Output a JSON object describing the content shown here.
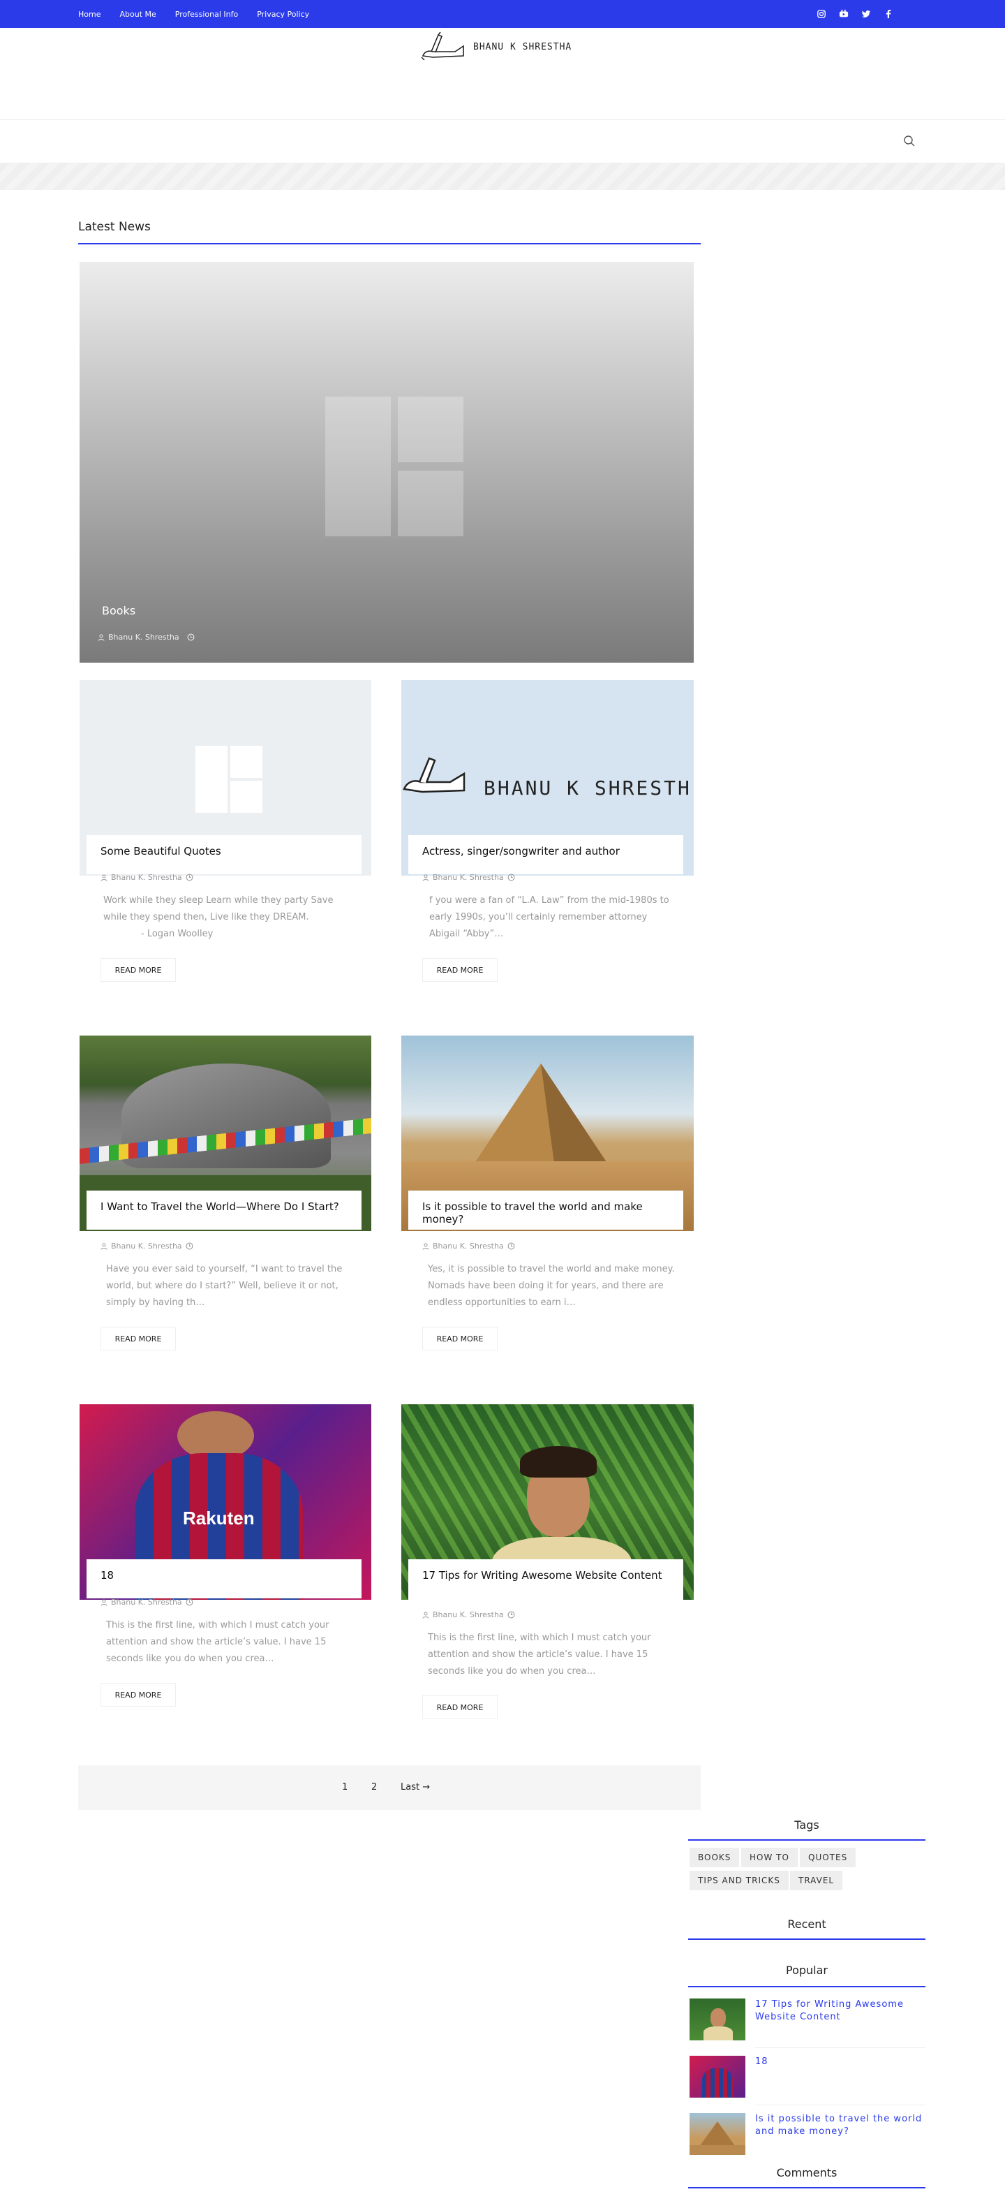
{
  "nav": {
    "items": [
      "Home",
      "About Me",
      "Professional Info",
      "Privacy Policy"
    ]
  },
  "social": [
    "instagram-icon",
    "youtube-icon",
    "twitter-icon",
    "facebook-icon"
  ],
  "brand": {
    "logo_text": "BHANU K SHRESTHA",
    "accent": "#2b3bea"
  },
  "latest": {
    "title": "Latest News"
  },
  "hero": {
    "title": "Books",
    "author": "Bhanu K. Shrestha"
  },
  "posts": [
    {
      "title": "Some Beautiful Quotes",
      "author": "Bhanu K. Shrestha",
      "excerpt": "Work while they sleep Learn while they party Save while they spend then, Live like they DREAM.",
      "excerpt2": "- Logan Woolley",
      "read_more": "READ MORE"
    },
    {
      "title": "Actress, singer/songwriter and author",
      "author": "Bhanu K. Shrestha",
      "excerpt": "f you were a fan of “L.A. Law” from the mid-1980s to early 1990s, you’ll certainly remember attorney Abigail “Abby”…",
      "read_more": "READ MORE",
      "image_text": "BHANU K SHRESTH"
    },
    {
      "title": "I Want to Travel the World—Where Do I Start?",
      "author": "Bhanu K. Shrestha",
      "excerpt": "Have you ever said to yourself, “I want to travel the world, but where do I start?” Well, believe it or not, simply by having th…",
      "read_more": "READ MORE"
    },
    {
      "title": "Is it possible to travel the world and make money?",
      "author": "Bhanu K. Shrestha",
      "excerpt": "Yes, it is possible to travel the world and make money. Nomads have been doing it for years, and there are endless opportunities to earn i…",
      "read_more": "READ MORE"
    },
    {
      "title": "18",
      "author": "Bhanu K. Shrestha",
      "excerpt": "This is the first line, with which I must catch your attention and show the article’s value. I have  15 seconds  like you do when you crea…",
      "read_more": "READ MORE",
      "image_text": "Rakuten"
    },
    {
      "title": "17 Tips for Writing Awesome Website Content",
      "author": "Bhanu K. Shrestha",
      "excerpt": "This is the first line, with which I must catch your attention and show the article’s value. I have  15 seconds  like you do when you crea…",
      "read_more": "READ MORE"
    }
  ],
  "pagination": {
    "pages": [
      "1",
      "2"
    ],
    "last": "Last →"
  },
  "sidebar": {
    "tags_title": "Tags",
    "tags": [
      "BOOKS",
      "HOW TO",
      "QUOTES",
      "TIPS AND TRICKS",
      "TRAVEL"
    ],
    "recent_title": "Recent",
    "popular_title": "Popular",
    "popular": [
      "17 Tips for Writing Awesome Website Content",
      "18",
      "Is it possible to travel the world and make money?"
    ],
    "comments_title": "Comments"
  }
}
